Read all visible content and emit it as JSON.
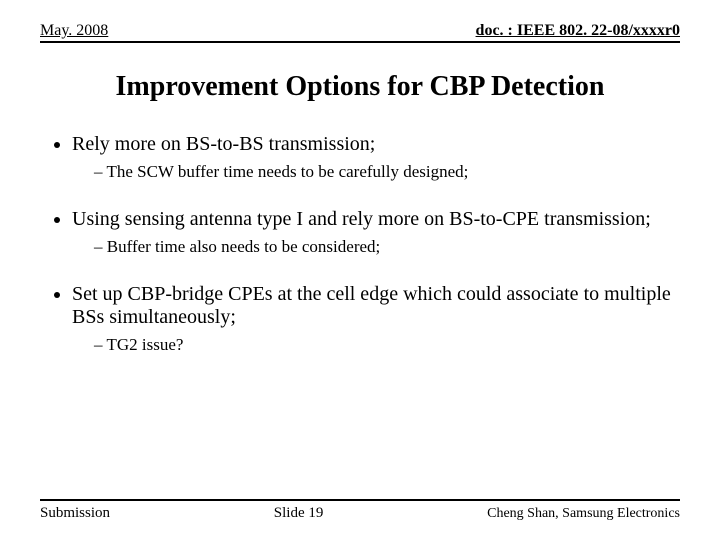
{
  "header": {
    "left": "May. 2008",
    "right": "doc. : IEEE 802. 22-08/xxxxr0"
  },
  "title": "Improvement Options for CBP Detection",
  "bullets": [
    {
      "text": "Rely more on BS-to-BS transmission;",
      "subs": [
        "The SCW buffer time needs to be carefully designed;"
      ]
    },
    {
      "text": "Using sensing antenna type I and rely more on BS-to-CPE transmission;",
      "subs": [
        "Buffer time also needs to be considered;"
      ]
    },
    {
      "text": "Set up CBP-bridge CPEs at the cell edge which could associate to multiple BSs simultaneously;",
      "subs": [
        "TG2 issue?"
      ]
    }
  ],
  "footer": {
    "left": "Submission",
    "center": "Slide 19",
    "right": "Cheng Shan, Samsung Electronics"
  }
}
